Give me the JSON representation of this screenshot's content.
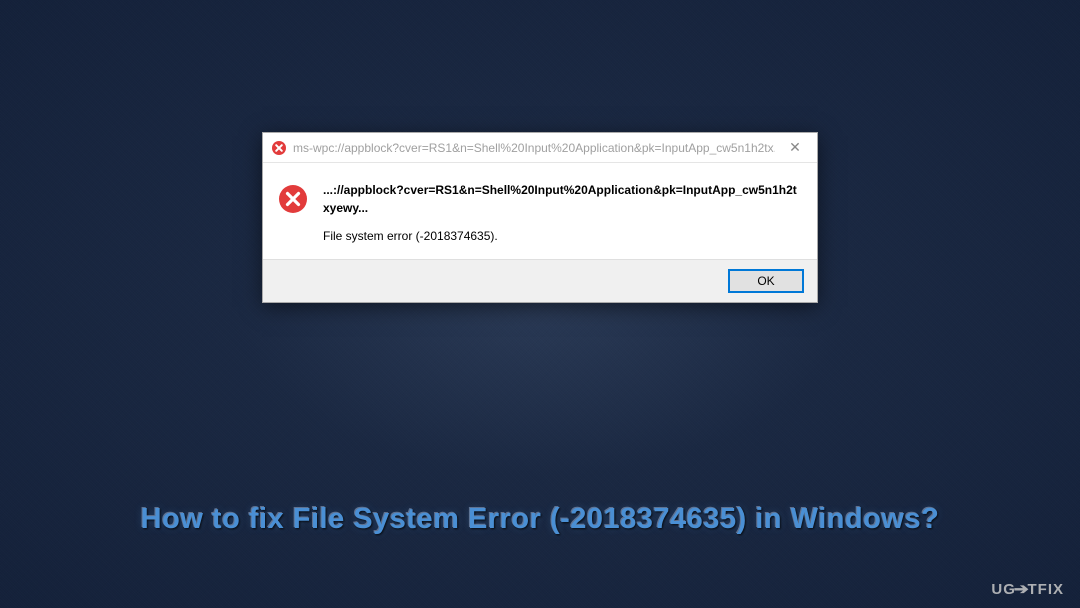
{
  "dialog": {
    "titlebar_text": "ms-wpc://appblock?cver=RS1&n=Shell%20Input%20Application&pk=InputApp_cw5n1h2tx...",
    "close_glyph": "✕",
    "headline": "...://appblock?cver=RS1&n=Shell%20Input%20Application&pk=InputApp_cw5n1h2txyewy...",
    "message": "File system error (-2018374635).",
    "ok_label": "OK"
  },
  "caption": "How to fix File System Error (-2018374635) in Windows?",
  "watermark": {
    "prefix": "UG",
    "suffix": "TFIX"
  }
}
